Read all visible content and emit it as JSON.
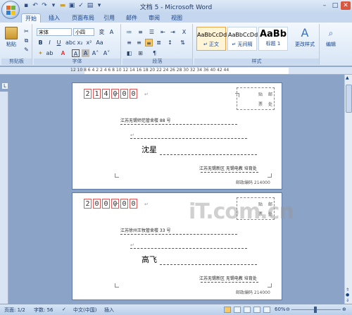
{
  "window": {
    "title": "文档 5 - Microsoft Word"
  },
  "tabs": [
    {
      "label": "开始",
      "active": true
    },
    {
      "label": "插入"
    },
    {
      "label": "页面布局"
    },
    {
      "label": "引用"
    },
    {
      "label": "邮件"
    },
    {
      "label": "审阅"
    },
    {
      "label": "视图"
    }
  ],
  "clipboard": {
    "paste_label": "粘贴",
    "group_label": "剪贴板"
  },
  "font": {
    "name": "宋体",
    "size": "小四",
    "group_label": "字体"
  },
  "paragraph": {
    "group_label": "段落"
  },
  "styles": {
    "group_label": "样式",
    "items": [
      {
        "sample": "AaBbCcDd",
        "name": "↵ 正文",
        "selected": true
      },
      {
        "sample": "AaBbCcDd",
        "name": "↵ 无间隔"
      },
      {
        "sample": "AaBb",
        "name": "标题 1"
      }
    ],
    "change_label": "更改样式"
  },
  "editing": {
    "label": "编辑"
  },
  "ruler": {
    "labels": "12 10 8 6 4 2 2 4 6 8 10 12 14 16 18 20 22 24 26 28 30 32 34 36 40 42 44"
  },
  "envelopes": [
    {
      "zip": [
        "2",
        "1",
        "4",
        "0",
        "0",
        "0"
      ],
      "stamp_text": [
        "贴",
        "邮",
        "票",
        "处"
      ],
      "address": "江苏无锡师范管舍楼 88 号",
      "name": "沈星",
      "sender": "江苏无锡新区 无锡电教 培育处",
      "sender_zip": "邮政编码 214000"
    },
    {
      "zip": [
        "2",
        "0",
        "0",
        "0",
        "0",
        "0"
      ],
      "stamp_text": [
        "贴",
        "邮",
        "票",
        "处"
      ],
      "address": "江苏徐州王牧管舍楼 33 号",
      "name": "高飞",
      "sender": "江苏无锡新区 无锡电教 培育处",
      "sender_zip": "邮政编码 214000"
    }
  ],
  "watermark": "iT.com.cn",
  "status": {
    "page": "页面: 1/2",
    "words": "字数: 56",
    "language": "中文(中国)",
    "insert": "插入",
    "zoom": "60%"
  },
  "colors": {
    "accent": "#15428b",
    "zip_border": "#e15a5a",
    "ribbon_bg": "#dfeaf7"
  }
}
